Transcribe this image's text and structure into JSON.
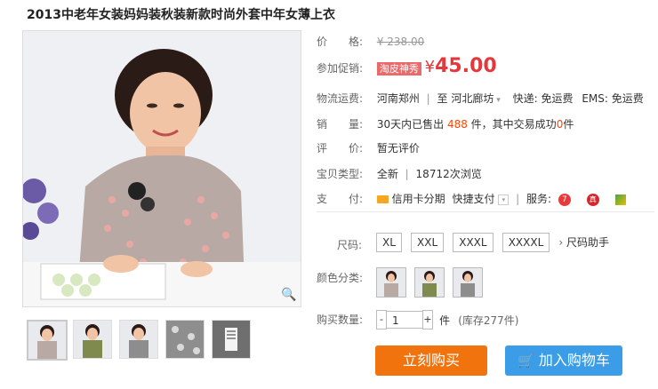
{
  "product": {
    "title": "2013中老年女装妈妈装秋装新款时尚外套中年女薄上衣"
  },
  "info": {
    "price_label": "价　　格:",
    "original_price": "¥ 238.00",
    "promo_label": "参加促销:",
    "promo_tag": "淘皮神秀",
    "promo_yen": "¥",
    "promo_price": "45.00",
    "shipping_label": "物流运费:",
    "ship_from": "河南郑州",
    "ship_to_prefix": "至",
    "ship_to": "河北廊坊",
    "ship_express": "快递: 免运费",
    "ship_ems": "EMS: 免运费",
    "sales_label": "销　　量:",
    "sales_prefix": "30天内已售出",
    "sales_count": "488",
    "sales_mid": "件，其中交易成功",
    "sales_success": "0",
    "sales_suffix": "件",
    "review_label": "评　　价:",
    "review_value": "暂无评价",
    "type_label": "宝贝类型:",
    "type_value": "全新",
    "views": "18712次浏览",
    "pay_label": "支　　付:",
    "pay_credit": "信用卡分期",
    "pay_quick": "快捷支付",
    "service_label": "服务:"
  },
  "purchase": {
    "size_label": "尺码:",
    "sizes": [
      "XL",
      "XXL",
      "XXXL",
      "XXXXL"
    ],
    "size_helper": "尺码助手",
    "color_label": "颜色分类:",
    "qty_label": "购买数量:",
    "qty_value": "1",
    "qty_unit": "件",
    "stock": "(库存277件)",
    "buy_now": "立刻购买",
    "add_cart": "加入购物车"
  }
}
